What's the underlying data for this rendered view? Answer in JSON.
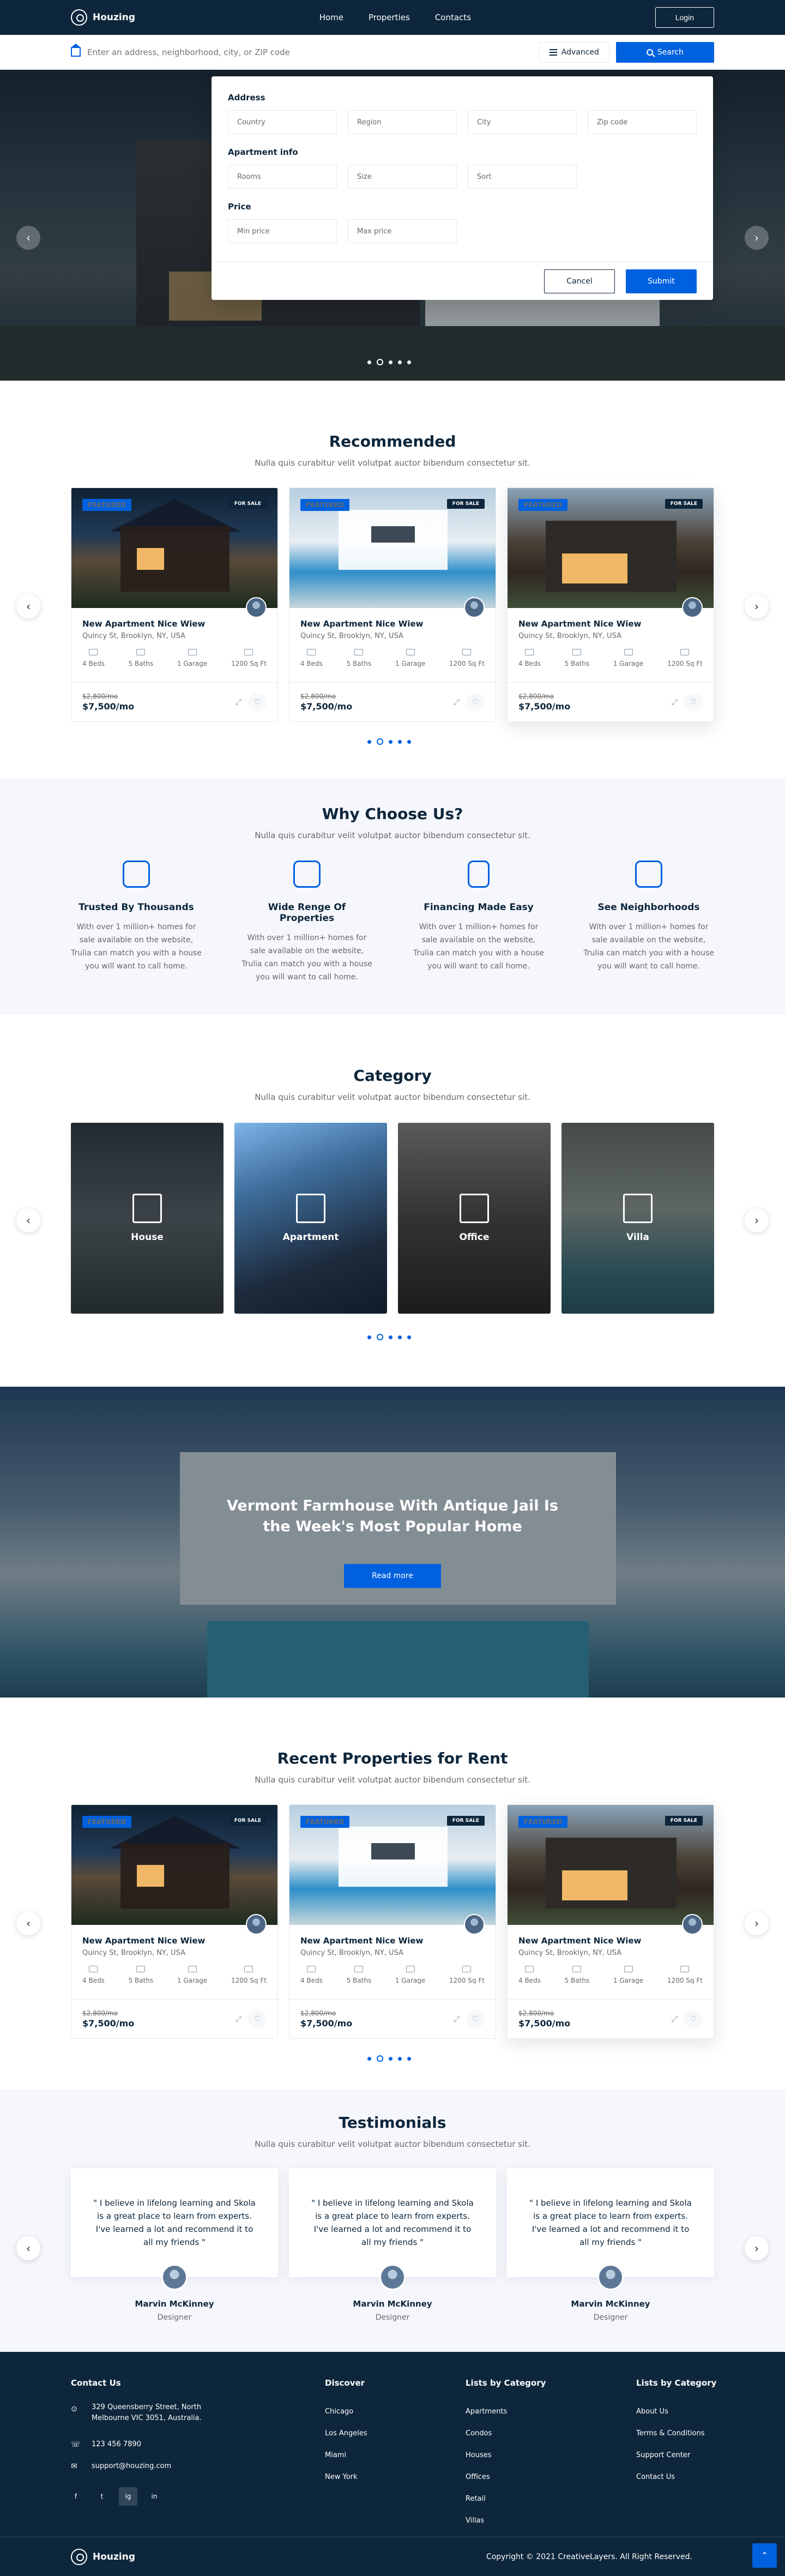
{
  "nav": {
    "brand": "Houzing",
    "links": [
      "Home",
      "Properties",
      "Contacts"
    ],
    "login": "Login"
  },
  "search": {
    "placeholder": "Enter an address, neighborhood, city, or ZIP code",
    "advanced": "Advanced",
    "submit": "Search"
  },
  "filter": {
    "address_heading": "Address",
    "address_fields": [
      "Country",
      "Region",
      "City",
      "Zip code"
    ],
    "apartment_heading": "Apartment info",
    "apartment_fields": [
      "Rooms",
      "Size",
      "Sort"
    ],
    "price_heading": "Price",
    "price_fields": [
      "Min price",
      "Max price"
    ],
    "cancel": "Cancel",
    "submit": "Submit"
  },
  "recommended": {
    "title": "Recommended",
    "subtitle": "Nulla quis curabitur velit volutpat auctor bibendum consectetur sit.",
    "cards": [
      {
        "featured": "FEATURED",
        "sale": "FOR SALE",
        "title": "New Apartment Nice Wiew",
        "address": "Quincy St, Brooklyn, NY, USA",
        "beds": "4 Beds",
        "baths": "5 Baths",
        "garage": "1 Garage",
        "size": "1200 Sq Ft",
        "old_price": "$2,800/mo",
        "price": "$7,500/mo"
      },
      {
        "featured": "FEATURED",
        "sale": "FOR SALE",
        "title": "New Apartment Nice Wiew",
        "address": "Quincy St, Brooklyn, NY, USA",
        "beds": "4 Beds",
        "baths": "5 Baths",
        "garage": "1 Garage",
        "size": "1200 Sq Ft",
        "old_price": "$2,800/mo",
        "price": "$7,500/mo"
      },
      {
        "featured": "FEATURED",
        "sale": "FOR SALE",
        "title": "New Apartment Nice Wiew",
        "address": "Quincy St, Brooklyn, NY, USA",
        "beds": "4 Beds",
        "baths": "5 Baths",
        "garage": "1 Garage",
        "size": "1200 Sq Ft",
        "old_price": "$2,800/mo",
        "price": "$7,500/mo"
      }
    ]
  },
  "why": {
    "title": "Why Choose Us?",
    "subtitle": "Nulla quis curabitur velit volutpat auctor bibendum consectetur sit.",
    "items": [
      {
        "icon": "chat-smile-icon",
        "title": "Trusted By Thousands",
        "text": "With over 1 million+ homes for sale available on the website, Trulia can match you with a house you will want to call home."
      },
      {
        "icon": "house-icon",
        "title": "Wide Renge Of Properties",
        "text": "With over 1 million+ homes for sale available on the website, Trulia can match you with a house you will want to call home."
      },
      {
        "icon": "calculator-icon",
        "title": "Financing Made Easy",
        "text": "With over 1 million+ homes for sale available on the website, Trulia can match you with a house you will want to call home."
      },
      {
        "icon": "map-pin-icon",
        "title": "See Neighborhoods",
        "text": "With over 1 million+ homes for sale available on the website, Trulia can match you with a house you will want to call home."
      }
    ]
  },
  "category": {
    "title": "Category",
    "subtitle": "Nulla quis curabitur velit volutpat auctor bibendum consectetur sit.",
    "items": [
      "House",
      "Apartment",
      "Office",
      "Villa"
    ]
  },
  "banner": {
    "headline_1": "Vermont Farmhouse With Antique Jail Is",
    "headline_2": "the Week's Most Popular Home",
    "cta": "Read more"
  },
  "rent": {
    "title": "Recent Properties for Rent",
    "subtitle": "Nulla quis curabitur velit volutpat auctor bibendum consectetur sit.",
    "cards": [
      {
        "featured": "FEATURED",
        "sale": "FOR SALE",
        "title": "New Apartment Nice Wiew",
        "address": "Quincy St, Brooklyn, NY, USA",
        "beds": "4 Beds",
        "baths": "5 Baths",
        "garage": "1 Garage",
        "size": "1200 Sq Ft",
        "old_price": "$2,800/mo",
        "price": "$7,500/mo"
      },
      {
        "featured": "FEATURED",
        "sale": "FOR SALE",
        "title": "New Apartment Nice Wiew",
        "address": "Quincy St, Brooklyn, NY, USA",
        "beds": "4 Beds",
        "baths": "5 Baths",
        "garage": "1 Garage",
        "size": "1200 Sq Ft",
        "old_price": "$2,800/mo",
        "price": "$7,500/mo"
      },
      {
        "featured": "FEATURED",
        "sale": "FOR SALE",
        "title": "New Apartment Nice Wiew",
        "address": "Quincy St, Brooklyn, NY, USA",
        "beds": "4 Beds",
        "baths": "5 Baths",
        "garage": "1 Garage",
        "size": "1200 Sq Ft",
        "old_price": "$2,800/mo",
        "price": "$7,500/mo"
      }
    ]
  },
  "testimonials": {
    "title": "Testimonials",
    "subtitle": "Nulla quis curabitur velit volutpat auctor bibendum consectetur sit.",
    "items": [
      {
        "quote": "\" I believe in lifelong learning and Skola is a great place to learn from experts. I've learned a lot and recommend it to all my friends \"",
        "name": "Marvin McKinney",
        "role": "Designer"
      },
      {
        "quote": "\" I believe in lifelong learning and Skola is a great place to learn from experts. I've learned a lot and recommend it to all my friends \"",
        "name": "Marvin McKinney",
        "role": "Designer"
      },
      {
        "quote": "\" I believe in lifelong learning and Skola is a great place to learn from experts. I've learned a lot and recommend it to all my friends \"",
        "name": "Marvin McKinney",
        "role": "Designer"
      }
    ]
  },
  "footer": {
    "contact_heading": "Contact Us",
    "address_line1": "329 Queensberry Street, North",
    "address_line2": "Melbourne VIC 3051, Australia.",
    "phone": "123 456 7890",
    "email": "support@houzing.com",
    "social": [
      "f",
      "t",
      "ig",
      "in"
    ],
    "discover_heading": "Discover",
    "discover": [
      "Chicago",
      "Los Angeles",
      "Miami",
      "New York"
    ],
    "lists_heading": "Lists by Category",
    "lists": [
      "Apartments",
      "Condos",
      "Houses",
      "Offices",
      "Retail",
      "Villas"
    ],
    "lists2_heading": "Lists by Category",
    "lists2": [
      "About Us",
      "Terms & Conditions",
      "Support Center",
      "Contact Us"
    ],
    "brand": "Houzing",
    "copyright": "Copyright © 2021 CreativeLayers. All Right Reserved."
  },
  "colors": {
    "navy": "#0d263b",
    "accent": "#0061df",
    "muted": "#696969",
    "section_bg": "#f5f7fc"
  }
}
